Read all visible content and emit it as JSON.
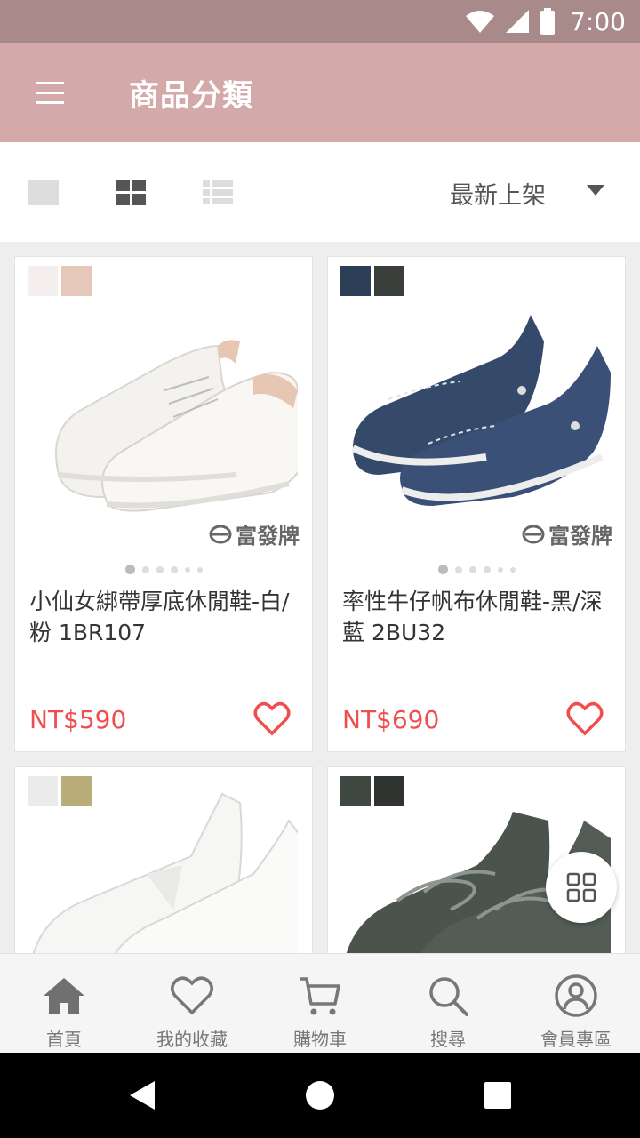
{
  "status_bar": {
    "time": "7:00"
  },
  "app_bar": {
    "title": "商品分類"
  },
  "toolbar": {
    "sort_label": "最新上架"
  },
  "products": [
    {
      "name": "小仙女綁帶厚底休閒鞋-白/粉 1BR107",
      "price": "NT$590",
      "brand": "富發牌",
      "swatches": [
        "#f4eeef",
        "#e6c8bb"
      ]
    },
    {
      "name": "率性牛仔帆布休閒鞋-黑/深藍 2BU32",
      "price": "NT$690",
      "brand": "富發牌",
      "swatches": [
        "#2d3e57",
        "#3a3f3b"
      ]
    },
    {
      "name": "",
      "price": "",
      "brand": "",
      "swatches": [
        "#ebebeb",
        "#b9ad7a"
      ]
    },
    {
      "name": "",
      "price": "",
      "brand": "",
      "swatches": [
        "#3e4740",
        "#2f3431"
      ]
    }
  ],
  "bottom_nav": [
    {
      "label": "首頁",
      "icon": "home-icon"
    },
    {
      "label": "我的收藏",
      "icon": "heart-icon"
    },
    {
      "label": "購物車",
      "icon": "cart-icon"
    },
    {
      "label": "搜尋",
      "icon": "search-icon"
    },
    {
      "label": "會員專區",
      "icon": "user-icon"
    }
  ],
  "colors": {
    "app_bar": "#d3a9aa",
    "status_bar": "#a88a8a",
    "price": "#f04d4d",
    "heart": "#f04d4d"
  }
}
